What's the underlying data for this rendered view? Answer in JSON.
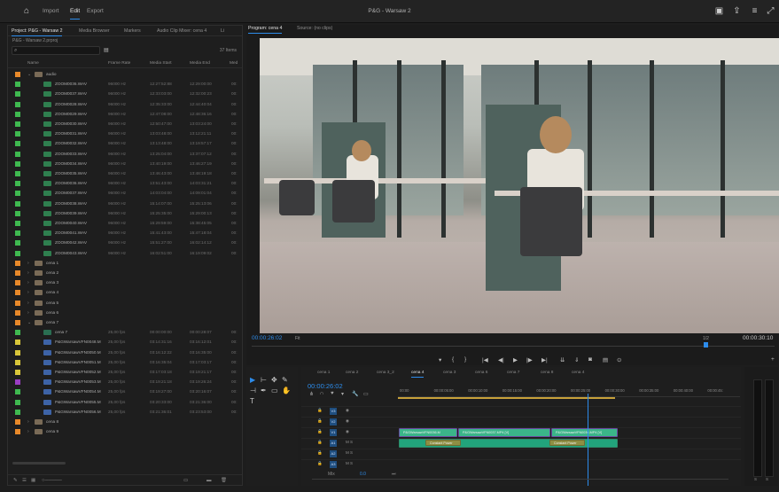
{
  "topbar": {
    "home_icon": "home-icon",
    "nav": [
      "Import",
      "Edit",
      "Export"
    ],
    "active_nav": "Edit",
    "title": "P&G - Warsaw 2",
    "right_icons": [
      "workspaces-icon",
      "share-icon",
      "menu-icon",
      "maximize-icon"
    ]
  },
  "project": {
    "tabs": [
      "Project: P&G - Warsaw 2",
      "Media Browser",
      "Markers",
      "Audio Clip Mixer: cena 4",
      "Li"
    ],
    "bin_path": "P&G - Warsaw 2.prproj",
    "search_icon": "search-icon",
    "item_count": "37 Items",
    "columns": [
      "Name",
      "Frame Rate",
      "Media Start",
      "Media End",
      "Med"
    ],
    "audio_bin": "audio",
    "wav_rows": [
      {
        "name": "ZOOM0036.WAV",
        "rate": "96000 Hz",
        "start": "12:27:52:88",
        "end": "12:29:00:00",
        "c": "00:"
      },
      {
        "name": "ZOOM0037.WAV",
        "rate": "96000 Hz",
        "start": "12:33:03:00",
        "end": "12:32:00:23",
        "c": "00:"
      },
      {
        "name": "ZOOM0028.WAV",
        "rate": "96000 Hz",
        "start": "12:35:33:00",
        "end": "12:44:40:04",
        "c": "00:"
      },
      {
        "name": "ZOOM0029.WAV",
        "rate": "96000 Hz",
        "start": "12:47:08:00",
        "end": "12:48:36:16",
        "c": "00:"
      },
      {
        "name": "ZOOM0030.WAV",
        "rate": "96000 Hz",
        "start": "12:50:47:00",
        "end": "13:03:24:00",
        "c": "00:"
      },
      {
        "name": "ZOOM0031.WAV",
        "rate": "96000 Hz",
        "start": "13:03:48:00",
        "end": "13:12:21:11",
        "c": "00:"
      },
      {
        "name": "ZOOM0032.WAV",
        "rate": "96000 Hz",
        "start": "13:13:48:00",
        "end": "13:19:57:17",
        "c": "00:"
      },
      {
        "name": "ZOOM0033.WAV",
        "rate": "96000 Hz",
        "start": "13:25:04:00",
        "end": "13:37:07:12",
        "c": "00:"
      },
      {
        "name": "ZOOM0034.WAV",
        "rate": "96000 Hz",
        "start": "13:40:19:00",
        "end": "13:46:27:19",
        "c": "00:"
      },
      {
        "name": "ZOOM0035.WAV",
        "rate": "96000 Hz",
        "start": "13:46:43:00",
        "end": "13:48:19:18",
        "c": "00:"
      },
      {
        "name": "ZOOM0036.WAV",
        "rate": "96000 Hz",
        "start": "13:51:43:00",
        "end": "14:03:31:21",
        "c": "00:"
      },
      {
        "name": "ZOOM0037.WAV",
        "rate": "96000 Hz",
        "start": "14:03:04:00",
        "end": "14:09:01:04",
        "c": "00:"
      },
      {
        "name": "ZOOM0038.WAV",
        "rate": "96000 Hz",
        "start": "15:14:07:00",
        "end": "15:25:13:06",
        "c": "00:"
      },
      {
        "name": "ZOOM0039.WAV",
        "rate": "96000 Hz",
        "start": "15:25:35:00",
        "end": "15:29:00:13",
        "c": "00:"
      },
      {
        "name": "ZOOM0040.WAV",
        "rate": "96000 Hz",
        "start": "15:29:59:00",
        "end": "15:38:45:05",
        "c": "00:"
      },
      {
        "name": "ZOOM0041.WAV",
        "rate": "96000 Hz",
        "start": "15:41:43:00",
        "end": "15:47:18:04",
        "c": "00:"
      },
      {
        "name": "ZOOM0042.WAV",
        "rate": "96000 Hz",
        "start": "15:51:27:00",
        "end": "16:02:14:12",
        "c": "00:"
      },
      {
        "name": "ZOOM0043.WAV",
        "rate": "96000 Hz",
        "start": "16:02:51:00",
        "end": "16:19:09:02",
        "c": "00:"
      }
    ],
    "bins_a": [
      "cena 1",
      "cena 2",
      "cena 3",
      "cena 4",
      "cena 5",
      "cena 6",
      "cena 7"
    ],
    "seq_row": {
      "name": "cena 7",
      "rate": "25,00 fps",
      "start": "00:00:00:00",
      "end": "00:00:28:07",
      "c": "00:"
    },
    "mp4_rows": [
      {
        "name": "P&GWarsawVFN0048.M",
        "rate": "25,00 fps",
        "start": "03:14:31:16",
        "end": "03:16:12:01",
        "c": "00:"
      },
      {
        "name": "P&GWarsawVFN0050.M",
        "rate": "25,00 fps",
        "start": "03:16:12:22",
        "end": "03:16:35:00",
        "c": "00:"
      },
      {
        "name": "P&GWarsawVFN0051.M",
        "rate": "25,00 fps",
        "start": "03:16:35:04",
        "end": "03:17:03:17",
        "c": "00:"
      },
      {
        "name": "P&GWarsawVFN0052.M",
        "rate": "25,00 fps",
        "start": "03:17:03:18",
        "end": "03:19:21:17",
        "c": "00:"
      },
      {
        "name": "P&GWarsawVFN0053.M",
        "rate": "25,00 fps",
        "start": "03:19:21:18",
        "end": "03:19:26:24",
        "c": "00:"
      },
      {
        "name": "P&GWarsawVFN0054.M",
        "rate": "25,00 fps",
        "start": "03:19:27:00",
        "end": "03:20:16:07",
        "c": "00:"
      },
      {
        "name": "P&GWarsawVFN0055.M",
        "rate": "25,00 fps",
        "start": "03:20:33:00",
        "end": "03:21:36:00",
        "c": "00:"
      },
      {
        "name": "P&GWarsawVFN0056.M",
        "rate": "25,00 fps",
        "start": "03:21:36:01",
        "end": "03:23:53:00",
        "c": "00:"
      }
    ],
    "bins_b": [
      "cena 8",
      "cena 9"
    ]
  },
  "program": {
    "tabs": [
      "Program: cena 4",
      "Source: (no clips)"
    ],
    "timecode": "00:00:26:02",
    "fit": "Fit",
    "quality": "1/2",
    "duration": "00:00:30:10",
    "controls": [
      "add-marker-icon",
      "mark-in-icon",
      "mark-out-icon",
      "go-to-in-icon",
      "step-back-icon",
      "play-icon",
      "step-forward-icon",
      "go-to-out-icon",
      "insert-icon",
      "overwrite-icon",
      "export-frame-icon",
      "button-editor-icon"
    ]
  },
  "timeline": {
    "seq_tabs": [
      "cena 1",
      "cena 2",
      "cena 3_2",
      "cena 4",
      "cena 3",
      "cena 6",
      "cena 7",
      "cena 8",
      "cena 4"
    ],
    "active_tab": "cena 4",
    "timecode": "00:00:26:02",
    "ruler": [
      "00:00",
      "00:00:05:00",
      "00:00:10:00",
      "00:00:15:00",
      "00:00:20:00",
      "00:00:25:00",
      "00:00:30:00",
      "00:00:35:00",
      "00:00:40:00",
      "00:00:45:"
    ],
    "video_tracks": [
      "V3",
      "V2",
      "V1"
    ],
    "audio_tracks": [
      "A1",
      "A2",
      "A3"
    ],
    "mix": "Mix",
    "mix_value": "0.0",
    "v1_clips": [
      "P&GWarsawVFN0036.M",
      "P&GWarsawVFN0037.MP4 [V]",
      "P&GWarsawVFN0036.MP4 [V]"
    ],
    "a1_clips": [
      "Constant Power",
      "Constant Power"
    ]
  },
  "colors": {
    "accent": "#2d8ceb",
    "swatch_green": "#3fb950",
    "swatch_orange": "#e8892a",
    "swatch_yellow": "#d8c63a",
    "swatch_purple": "#9a3ec2",
    "clip_green": "#3bb589"
  }
}
